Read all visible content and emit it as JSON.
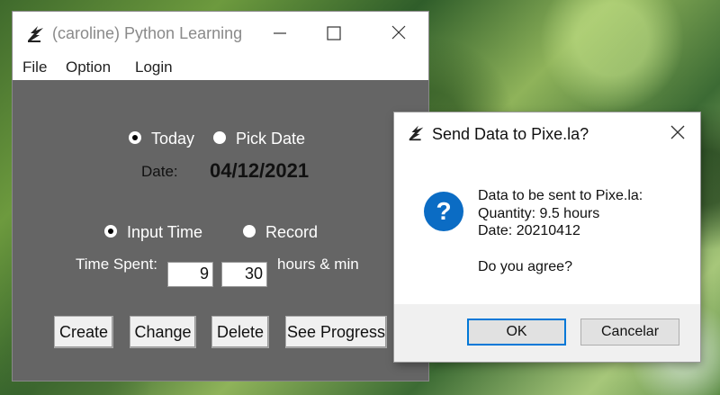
{
  "main_window": {
    "title": "(caroline) Python Learning",
    "menu": [
      "File",
      "Option",
      "Login"
    ],
    "date_mode": {
      "today_label": "Today",
      "pick_label": "Pick Date",
      "selected": "today"
    },
    "date_label": "Date:",
    "date_value": "04/12/2021",
    "time_mode": {
      "input_label": "Input Time",
      "record_label": "Record",
      "selected": "input"
    },
    "time_spent_label": "Time Spent:",
    "hours_value": "9",
    "minutes_value": "30",
    "unit_label": "hours & min",
    "buttons": {
      "create": "Create",
      "change": "Change",
      "delete": "Delete",
      "progress": "See Progress"
    }
  },
  "dialog": {
    "title": "Send Data to Pixe.la?",
    "message_lines": [
      "Data to be sent to Pixe.la:",
      "Quantity: 9.5 hours",
      "Date: 20210412",
      "",
      "Do you agree?"
    ],
    "ok_label": "OK",
    "cancel_label": "Cancelar",
    "accent_color": "#0078d7"
  },
  "icons": [
    "app-feather-icon",
    "minimize-icon",
    "maximize-icon",
    "close-icon",
    "question-icon"
  ]
}
